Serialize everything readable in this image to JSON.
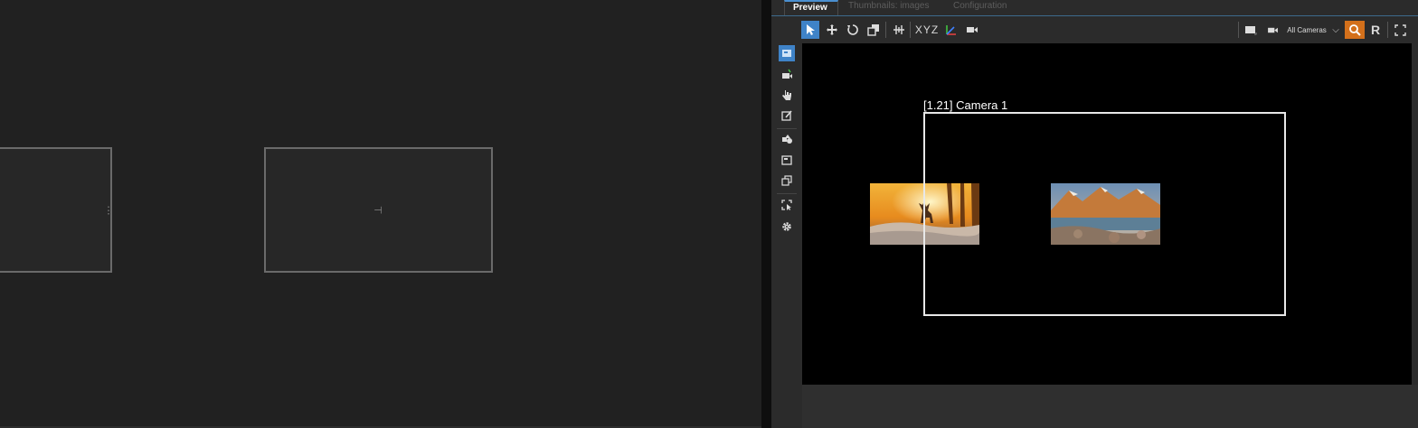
{
  "preview": {
    "tabs": [
      {
        "label": "Preview",
        "active": true
      },
      {
        "label": "Thumbnails: images",
        "active": false
      },
      {
        "label": "Configuration",
        "active": false
      }
    ],
    "camera_dropdown": "All Cameras",
    "r_button": "R",
    "xyz_label": "XYZ",
    "camera_label": "[1.21] Camera 1"
  },
  "colors": {
    "accent": "#3f83c8",
    "search_active": "#d3701b",
    "viewport": "#000000"
  }
}
